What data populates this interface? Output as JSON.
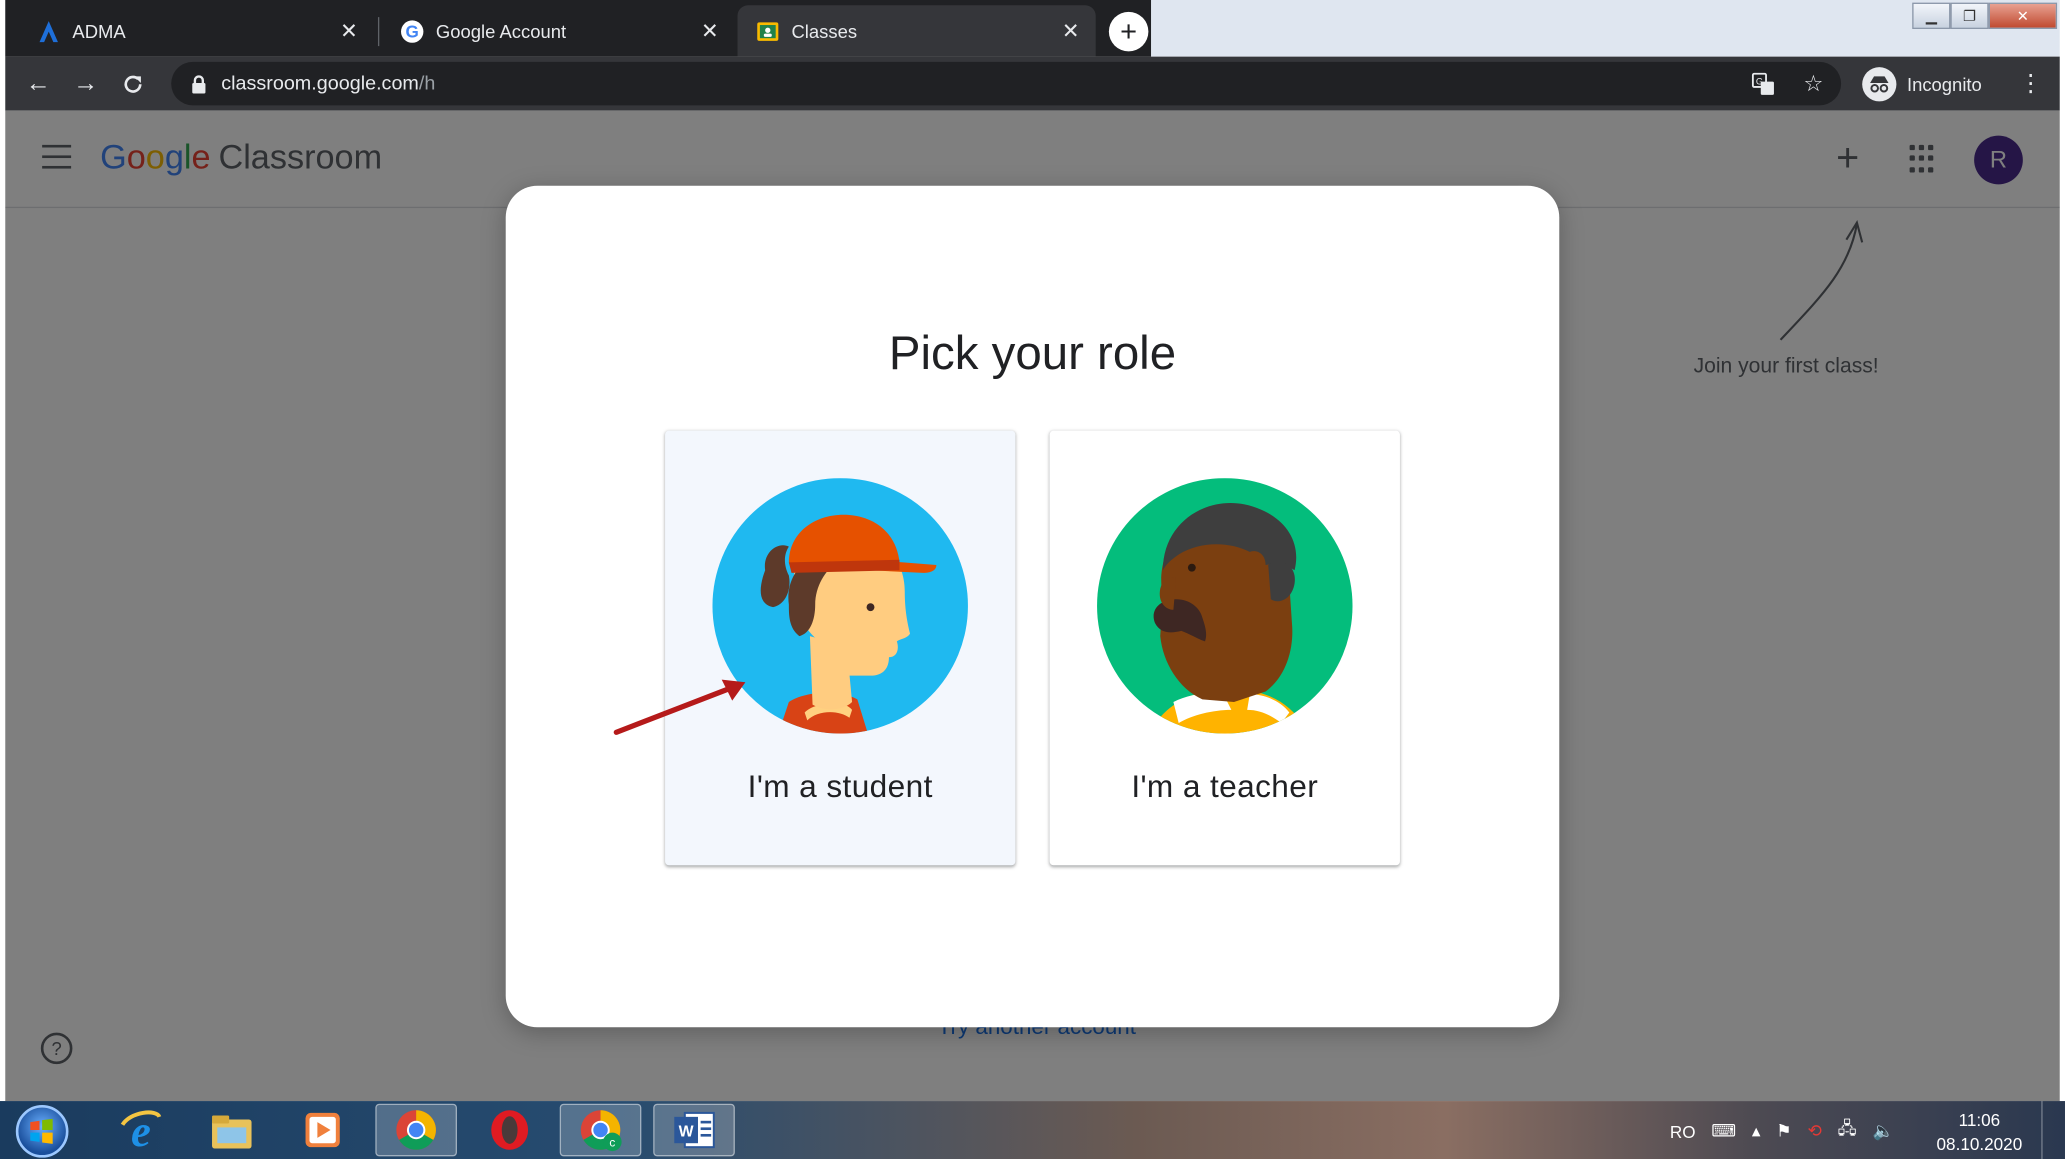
{
  "browser": {
    "tabs": [
      {
        "title": "ADMA",
        "active": false
      },
      {
        "title": "Google Account",
        "active": false
      },
      {
        "title": "Classes",
        "active": true
      }
    ],
    "address": {
      "host": "classroom.google.com",
      "path": "/h"
    },
    "mode_label": "Incognito"
  },
  "app": {
    "logo_google": "Google",
    "logo_product": "Classroom",
    "avatar_letter": "R",
    "hint": "Join your first class!",
    "try_another": "Try another account"
  },
  "dialog": {
    "title": "Pick your role",
    "roles": [
      {
        "label": "I'm a student",
        "selected": true
      },
      {
        "label": "I'm a teacher",
        "selected": false
      }
    ]
  },
  "taskbar": {
    "language": "RO",
    "time": "11:06",
    "date": "08.10.2020"
  },
  "colors": {
    "google_blue": "#4285F4",
    "google_red": "#EA4335",
    "google_yellow": "#FBBC05",
    "google_green": "#34A853",
    "avatar_bg": "#4a2a8c",
    "student_bg": "#1fb9f0",
    "teacher_bg": "#04bd7c",
    "arrow_red": "#b51a1a"
  }
}
